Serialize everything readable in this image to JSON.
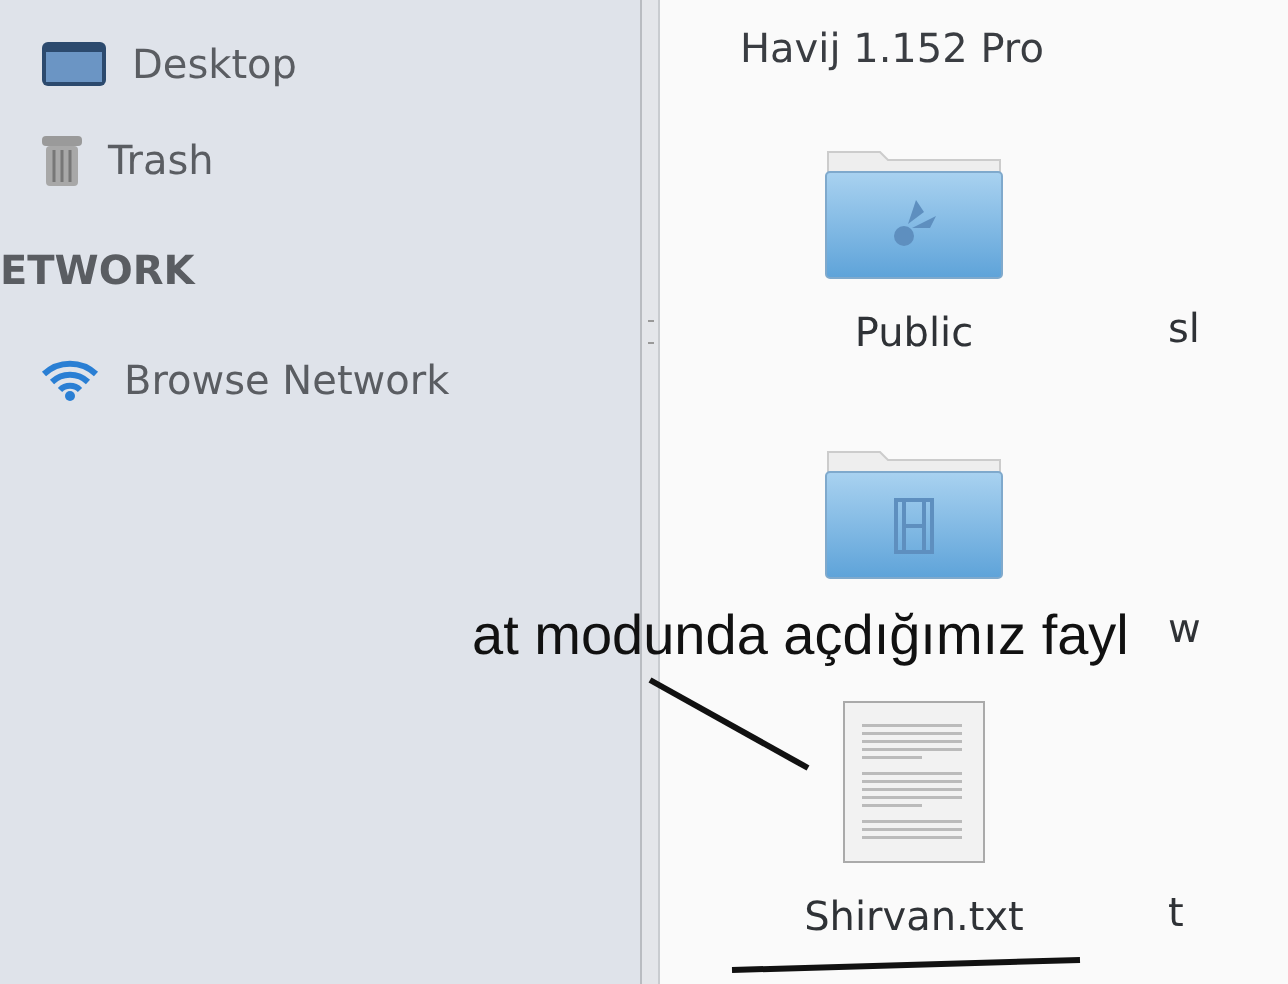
{
  "sidebar": {
    "items": [
      {
        "kind": "desktop",
        "label": "Desktop"
      },
      {
        "kind": "trash",
        "label": "Trash"
      }
    ],
    "network_heading": "ETWORK",
    "network_items": [
      {
        "kind": "network",
        "label": "Browse Network"
      }
    ]
  },
  "location_title": "Havij 1.152 Pro",
  "files": [
    {
      "kind": "public-folder",
      "label": "Public",
      "neighbor": "sl"
    },
    {
      "kind": "video-folder",
      "neighbor": "w"
    },
    {
      "kind": "text-file",
      "label": "Shirvan.txt",
      "neighbor": "t"
    }
  ],
  "annotation": {
    "text": "at modunda açdığımız fayl"
  }
}
